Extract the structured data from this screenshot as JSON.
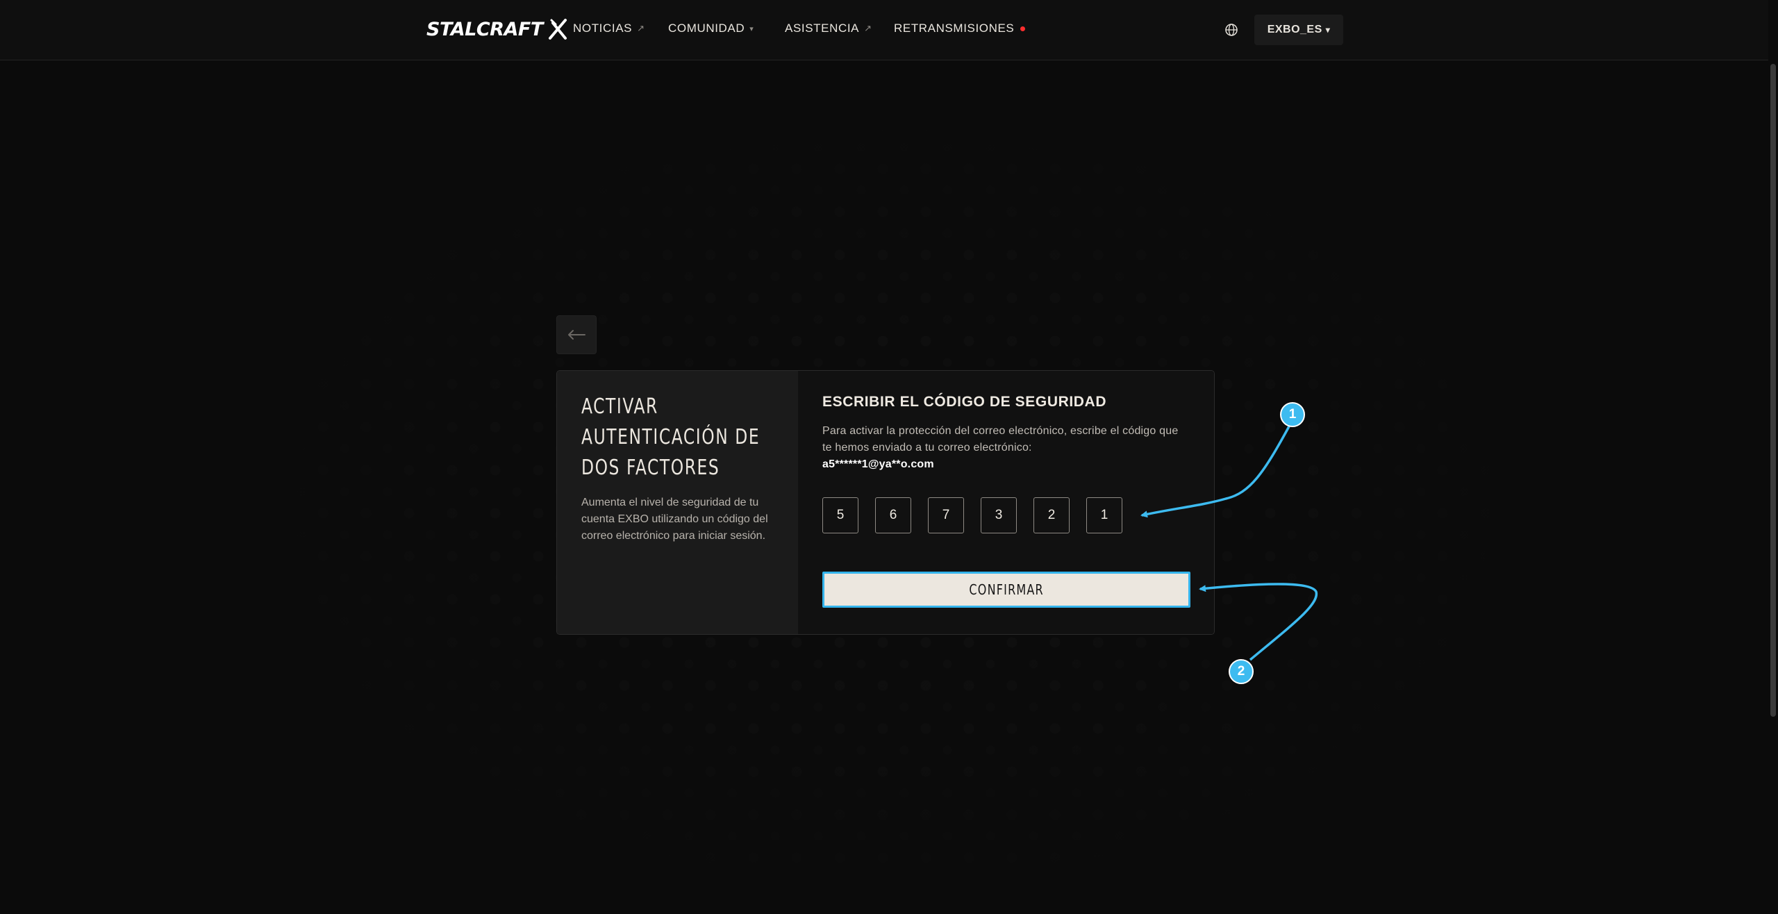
{
  "header": {
    "logo": "STALCRAFT",
    "nav": [
      {
        "label": "NOTICIAS",
        "suffix": "↗"
      },
      {
        "label": "COMUNIDAD",
        "suffix": "▾"
      },
      {
        "label": "ASISTENCIA",
        "suffix": "↗"
      },
      {
        "label": "RETRANSMISIONES",
        "live": true
      }
    ],
    "user": "EXBO_ES",
    "user_caret": "▾"
  },
  "back": {
    "icon": "arrow-left-icon"
  },
  "card": {
    "left": {
      "title_lines": [
        "ACTIVAR",
        "AUTENTICACIÓN DE",
        "DOS FACTORES"
      ],
      "description": "Aumenta el nivel de seguridad de tu cuenta EXBO utilizando un código del correo electrónico para iniciar sesión."
    },
    "right": {
      "title": "ESCRIBIR EL CÓDIGO DE SEGURIDAD",
      "description": "Para activar la protección del correo electrónico, escribe el código que te hemos enviado a tu correo electrónico:",
      "email": "a5******1@ya**o.com",
      "code": [
        "5",
        "6",
        "7",
        "3",
        "2",
        "1"
      ],
      "confirm": "CONFIRMAR"
    }
  },
  "annotations": {
    "badge1": "1",
    "badge2": "2",
    "color": "#3dbbf0"
  },
  "colors": {
    "background": "#0b0b0b",
    "card_left": "#1b1b1b",
    "card_right": "#111111",
    "button": "#ece7df",
    "accent": "#34b4ec",
    "live": "#ff2e2e"
  }
}
